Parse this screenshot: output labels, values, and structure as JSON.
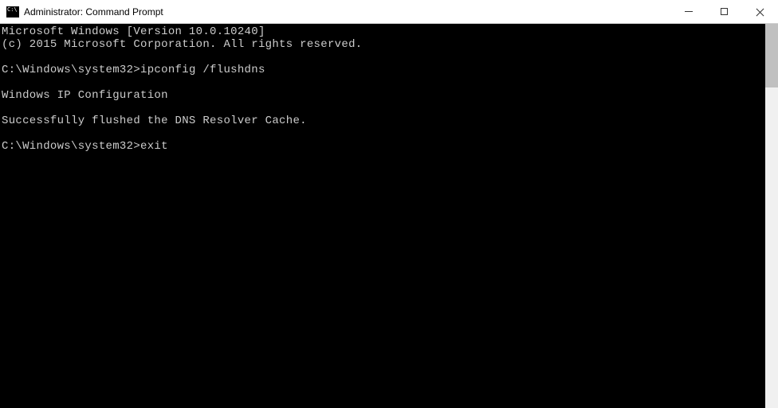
{
  "titlebar": {
    "title": "Administrator: Command Prompt"
  },
  "console": {
    "line1": "Microsoft Windows [Version 10.0.10240]",
    "line2": "(c) 2015 Microsoft Corporation. All rights reserved.",
    "blank1": "",
    "prompt1_path": "C:\\Windows\\system32>",
    "prompt1_cmd": "ipconfig /flushdns",
    "blank2": "",
    "line3": "Windows IP Configuration",
    "blank3": "",
    "line4": "Successfully flushed the DNS Resolver Cache.",
    "blank4": "",
    "prompt2_path": "C:\\Windows\\system32>",
    "prompt2_cmd": "exit"
  }
}
